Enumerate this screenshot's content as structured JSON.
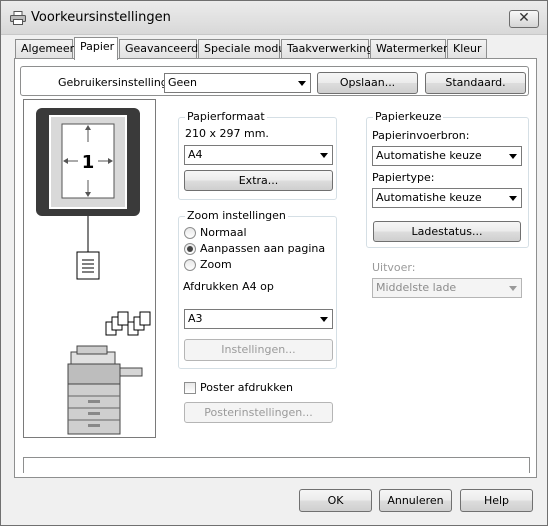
{
  "window": {
    "title": "Voorkeursinstellingen",
    "close_glyph": "✕"
  },
  "tabs": [
    {
      "label": "Algemeen"
    },
    {
      "label": "Papier"
    },
    {
      "label": "Geavanceerd"
    },
    {
      "label": "Speciale modus"
    },
    {
      "label": "Taakverwerking"
    },
    {
      "label": "Watermerken"
    },
    {
      "label": "Kleur"
    }
  ],
  "active_tab": "Papier",
  "user_settings": {
    "label": "Gebruikersinstellingen:",
    "value": "Geen",
    "save_label": "Opslaan...",
    "default_label": "Standaard."
  },
  "preview": {
    "page_number": "1"
  },
  "paper_size": {
    "group_label": "Papierformaat",
    "dimensions": "210 x 297 mm.",
    "value": "A4",
    "extra_label": "Extra..."
  },
  "zoom": {
    "group_label": "Zoom instellingen",
    "options": [
      {
        "label": "Normaal",
        "checked": false
      },
      {
        "label": "Aanpassen aan pagina",
        "checked": true
      },
      {
        "label": "Zoom",
        "checked": false
      }
    ],
    "print_label": "Afdrukken A4 op",
    "print_value": "A3",
    "settings_label": "Instellingen..."
  },
  "poster": {
    "label": "Poster afdrukken",
    "checked": false,
    "settings_label": "Posterinstellingen..."
  },
  "paper_choice": {
    "group_label": "Papierkeuze",
    "source_label": "Papierinvoerbron:",
    "source_value": "Automatishe keuze",
    "type_label": "Papiertype:",
    "type_value": "Automatishe keuze",
    "tray_status_label": "Ladestatus..."
  },
  "output": {
    "label": "Uitvoer:",
    "value": "Middelste lade"
  },
  "footer": {
    "ok_label": "OK",
    "cancel_label": "Annuleren",
    "help_label": "Help"
  }
}
